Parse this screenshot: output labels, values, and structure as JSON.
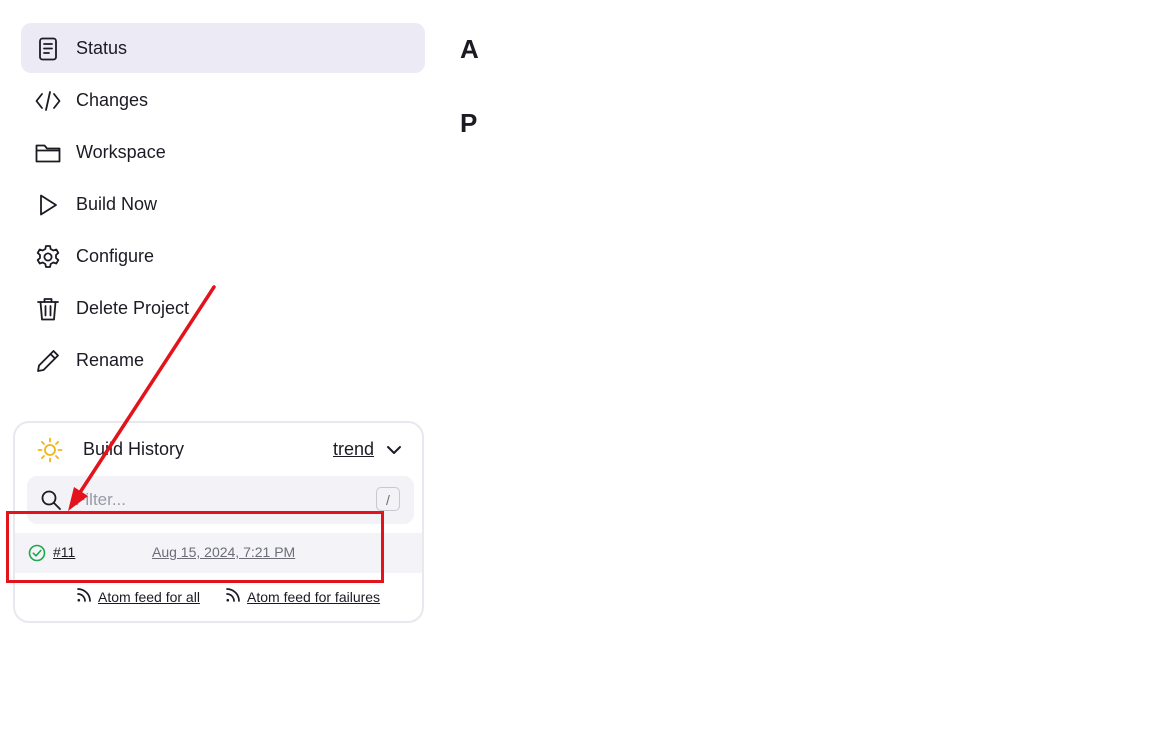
{
  "sidebar": {
    "items": [
      {
        "label": "Status",
        "icon": "document-icon",
        "active": true
      },
      {
        "label": "Changes",
        "icon": "code-icon"
      },
      {
        "label": "Workspace",
        "icon": "folder-icon"
      },
      {
        "label": "Build Now",
        "icon": "play-icon"
      },
      {
        "label": "Configure",
        "icon": "gear-icon"
      },
      {
        "label": "Delete Project",
        "icon": "trash-icon"
      },
      {
        "label": "Rename",
        "icon": "pencil-icon"
      }
    ]
  },
  "main": {
    "heading1": "A",
    "heading2": "P"
  },
  "build_history": {
    "title": "Build History",
    "trend_label": "trend",
    "filter_placeholder": "Filter...",
    "filter_shortcut": "/",
    "builds": [
      {
        "number": "#11",
        "date": "Aug 15, 2024, 7:21 PM",
        "status": "success"
      }
    ],
    "feed_all": "Atom feed for all",
    "feed_failures": "Atom feed for failures"
  },
  "colors": {
    "active_bg": "#ecebf5",
    "annotation": "#e3131b",
    "success": "#1ea64b",
    "sun": "#f2b416"
  }
}
